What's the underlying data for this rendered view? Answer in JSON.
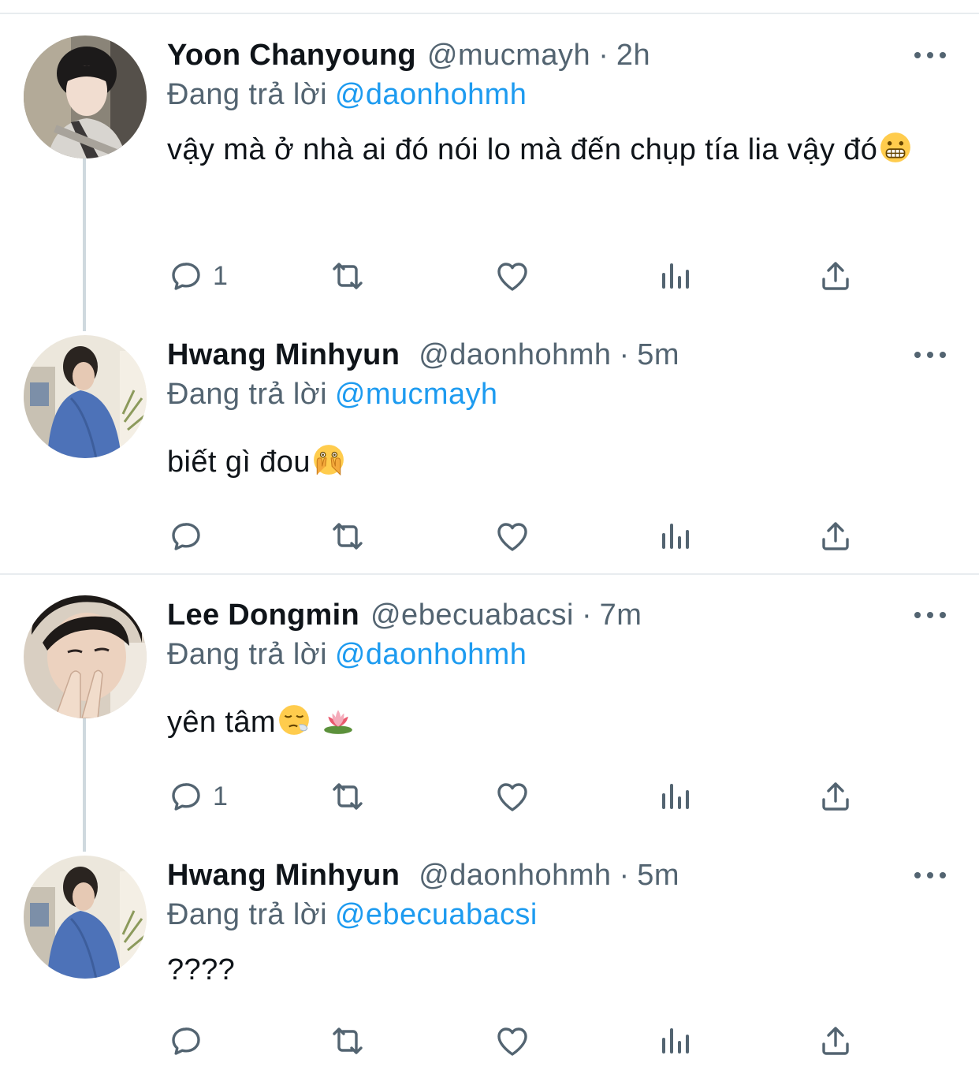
{
  "tweets": [
    {
      "name": "Yoon Chanyoung",
      "handle": "@mucmayh",
      "separator": "·",
      "time": "2h",
      "replying_label": "Đang trả lời",
      "replying_to": "@daonhohmh",
      "text": "vậy mà ở nhà ai đó nói lo mà đến chụp tía lia vậy đó",
      "emoji": "grimacing-face",
      "reply_count": "1"
    },
    {
      "name": "Hwang Minhyun",
      "handle": "@daonhohmh",
      "separator": "·",
      "time": "5m",
      "replying_label": "Đang trả lời",
      "replying_to": "@mucmayh",
      "text": "biết gì đou",
      "emoji": "face-with-open-eyes-and-hand-over-mouth",
      "reply_count": ""
    },
    {
      "name": "Lee Dongmin",
      "handle": "@ebecuabacsi",
      "separator": "·",
      "time": "7m",
      "replying_label": "Đang trả lời",
      "replying_to": "@daonhohmh",
      "text": "yên tâm",
      "emoji": "relieved-face, lotus",
      "reply_count": "1"
    },
    {
      "name": "Hwang Minhyun",
      "handle": "@daonhohmh",
      "separator": "·",
      "time": "5m",
      "replying_label": "Đang trả lời",
      "replying_to": "@ebecuabacsi",
      "text": "????",
      "emoji": "",
      "reply_count": ""
    }
  ],
  "icons": {
    "reply": "reply-icon",
    "retweet": "retweet-icon",
    "like": "heart-icon",
    "views": "views-icon",
    "share": "share-icon",
    "more": "more-icon"
  },
  "colors": {
    "text": "#0f1419",
    "secondary": "#536471",
    "mention": "#1d9bf0",
    "thread_line": "#cfd9de",
    "divider": "#e8ecef"
  }
}
